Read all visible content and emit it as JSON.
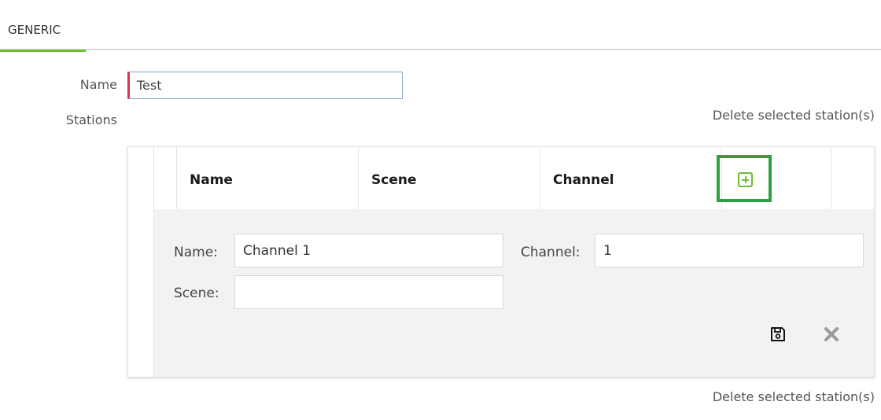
{
  "tabs": [
    {
      "label": "GENERIC",
      "active": true
    }
  ],
  "form": {
    "name_label": "Name",
    "name_value": "Test",
    "stations_label": "Stations"
  },
  "actions": {
    "delete_selected_label": "Delete selected station(s)"
  },
  "grid": {
    "columns": [
      "Name",
      "Scene",
      "Channel"
    ],
    "add_icon": "plus-square-icon"
  },
  "edit_row": {
    "name_label": "Name:",
    "name_value": "Channel 1",
    "scene_label": "Scene:",
    "scene_value": "",
    "channel_label": "Channel:",
    "channel_value": "1",
    "save_icon": "floppy-disk-icon",
    "cancel_icon": "close-x-icon"
  },
  "colors": {
    "accent": "#6cbf2f",
    "highlight": "#2ea043",
    "required": "#d6374b"
  }
}
